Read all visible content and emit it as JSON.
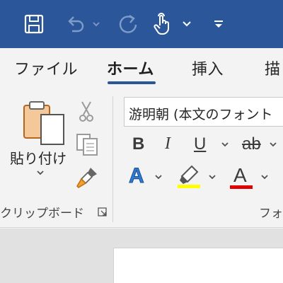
{
  "quick_access": {
    "icons": [
      "save-icon",
      "undo-icon",
      "redo-icon",
      "touch-mode-icon",
      "customize-toolbar-icon"
    ],
    "bg_color": "#2b579a"
  },
  "tabs": [
    {
      "label": "ファイル",
      "active": false
    },
    {
      "label": "ホーム",
      "active": true
    },
    {
      "label": "挿入",
      "active": false
    },
    {
      "label": "描",
      "active": false
    }
  ],
  "clipboard": {
    "paste_label": "貼り付け",
    "group_label": "クリップボード"
  },
  "font": {
    "font_name": "游明朝 (本文のフォント",
    "bold": "B",
    "italic": "I",
    "underline": "U",
    "strike": "ab",
    "text_effects": "A",
    "font_color": "A",
    "highlight_color": "#ffff00",
    "font_color_value": "#e00000",
    "group_label": "フォ"
  }
}
